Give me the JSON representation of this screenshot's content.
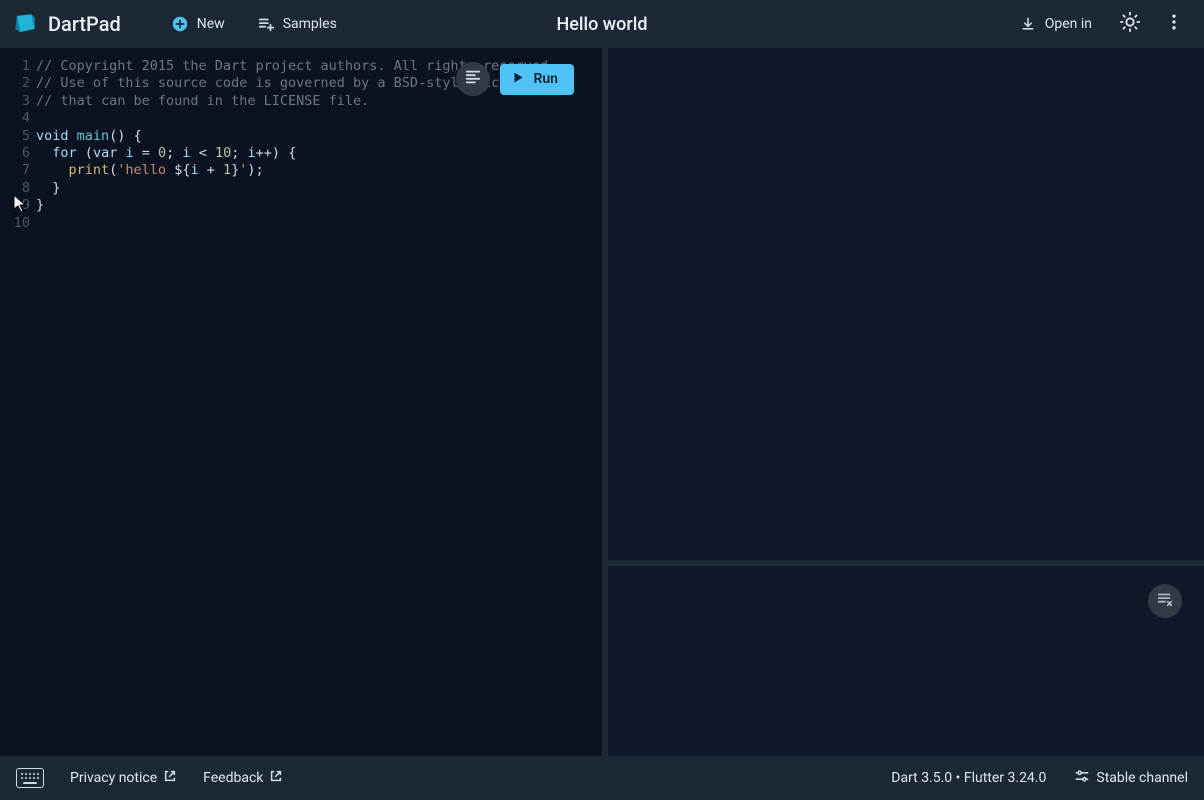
{
  "header": {
    "app_name": "DartPad",
    "new_label": "New",
    "samples_label": "Samples",
    "title": "Hello world",
    "open_in_label": "Open in"
  },
  "editor": {
    "line_numbers": [
      "1",
      "2",
      "3",
      "4",
      "5",
      "6",
      "7",
      "8",
      "9",
      "10"
    ],
    "code_plain": "// Copyright 2015 the Dart project authors. All rights reserved.\n// Use of this source code is governed by a BSD-style license\n// that can be found in the LICENSE file.\n\nvoid main() {\n  for (var i = 0; i < 10; i++) {\n    print('hello ${i + 1}');\n  }\n}\n",
    "tokens": [
      [
        {
          "c": "tok-comment",
          "t": "// Copyright 2015 the Dart project authors. All rights reserved."
        }
      ],
      [
        {
          "c": "tok-comment",
          "t": "// Use of this source code is governed by a BSD-style license"
        }
      ],
      [
        {
          "c": "tok-comment",
          "t": "// that can be found in the LICENSE file."
        }
      ],
      [],
      [
        {
          "c": "tok-keyword",
          "t": "void"
        },
        {
          "c": "tok-op",
          "t": " "
        },
        {
          "c": "tok-funcname",
          "t": "main"
        },
        {
          "c": "tok-punc",
          "t": "()"
        },
        {
          "c": "tok-op",
          "t": " "
        },
        {
          "c": "tok-punc",
          "t": "{"
        }
      ],
      [
        {
          "c": "tok-op",
          "t": "  "
        },
        {
          "c": "tok-keyword",
          "t": "for"
        },
        {
          "c": "tok-op",
          "t": " "
        },
        {
          "c": "tok-punc",
          "t": "("
        },
        {
          "c": "tok-keyword",
          "t": "var"
        },
        {
          "c": "tok-op",
          "t": " "
        },
        {
          "c": "tok-var",
          "t": "i"
        },
        {
          "c": "tok-op",
          "t": " = "
        },
        {
          "c": "tok-num",
          "t": "0"
        },
        {
          "c": "tok-punc",
          "t": ";"
        },
        {
          "c": "tok-op",
          "t": " "
        },
        {
          "c": "tok-var",
          "t": "i"
        },
        {
          "c": "tok-op",
          "t": " < "
        },
        {
          "c": "tok-num",
          "t": "10"
        },
        {
          "c": "tok-punc",
          "t": ";"
        },
        {
          "c": "tok-op",
          "t": " "
        },
        {
          "c": "tok-var",
          "t": "i"
        },
        {
          "c": "tok-op",
          "t": "++"
        },
        {
          "c": "tok-punc",
          "t": ")"
        },
        {
          "c": "tok-op",
          "t": " "
        },
        {
          "c": "tok-punc",
          "t": "{"
        }
      ],
      [
        {
          "c": "tok-op",
          "t": "    "
        },
        {
          "c": "tok-func",
          "t": "print"
        },
        {
          "c": "tok-punc",
          "t": "("
        },
        {
          "c": "tok-str",
          "t": "'hello "
        },
        {
          "c": "tok-op",
          "t": "${"
        },
        {
          "c": "tok-var",
          "t": "i"
        },
        {
          "c": "tok-op",
          "t": " + "
        },
        {
          "c": "tok-num",
          "t": "1"
        },
        {
          "c": "tok-op",
          "t": "}"
        },
        {
          "c": "tok-str",
          "t": "'"
        },
        {
          "c": "tok-punc",
          "t": ");"
        }
      ],
      [
        {
          "c": "tok-op",
          "t": "  "
        },
        {
          "c": "tok-punc",
          "t": "}"
        }
      ],
      [
        {
          "c": "tok-punc",
          "t": "}"
        }
      ],
      []
    ],
    "run_label": "Run"
  },
  "footer": {
    "privacy_label": "Privacy notice",
    "feedback_label": "Feedback",
    "version_label": "Dart 3.5.0 • Flutter 3.24.0",
    "channel_label": "Stable channel"
  }
}
